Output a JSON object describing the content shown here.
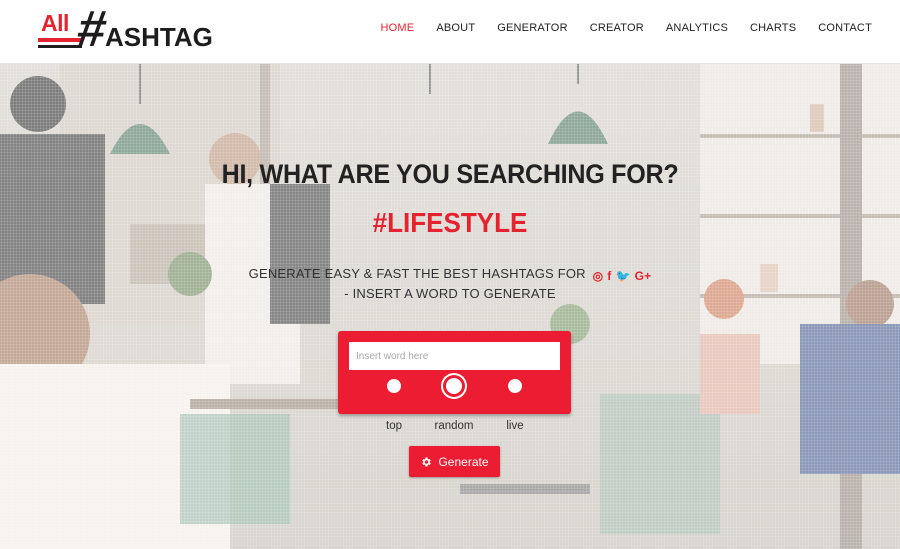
{
  "logo": {
    "all": "All",
    "hash": "#",
    "text": "ASHTAG"
  },
  "nav": [
    {
      "label": "HOME",
      "active": true
    },
    {
      "label": "ABOUT"
    },
    {
      "label": "GENERATOR"
    },
    {
      "label": "CREATOR"
    },
    {
      "label": "ANALYTICS"
    },
    {
      "label": "CHARTS"
    },
    {
      "label": "CONTACT"
    }
  ],
  "hero": {
    "headline": "HI, WHAT ARE YOU SEARCHING FOR?",
    "tagword": "#LIFESTYLE",
    "desc_line1": "GENERATE EASY & FAST THE BEST HASHTAGS FOR",
    "desc_line2": "- INSERT A WORD TO GENERATE",
    "social_icons": [
      "instagram-icon",
      "facebook-icon",
      "twitter-icon",
      "google-plus-icon"
    ],
    "social_glyphs": {
      "instagram": "◎",
      "facebook": "f",
      "twitter": "🐦",
      "google": "G+"
    }
  },
  "search": {
    "placeholder": "Insert word here",
    "value": "",
    "options": [
      {
        "label": "top",
        "selected": false
      },
      {
        "label": "random",
        "selected": true
      },
      {
        "label": "live",
        "selected": false
      }
    ]
  },
  "generate_button": {
    "label": "Generate",
    "icon": "gear-icon"
  },
  "colors": {
    "accent": "#e5222f",
    "panel": "#ec1c33",
    "text": "#222222"
  }
}
